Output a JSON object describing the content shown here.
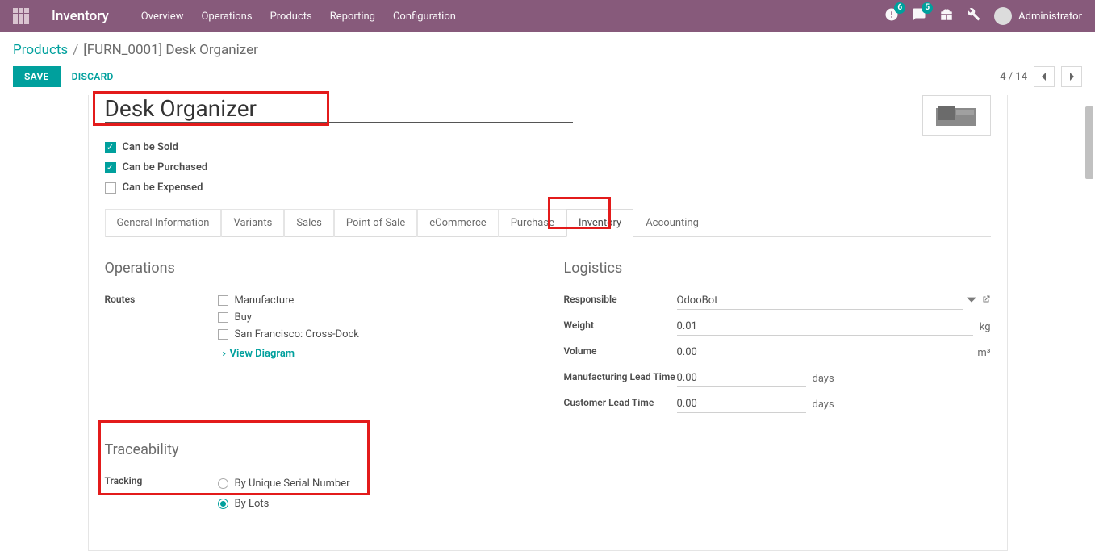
{
  "topbar": {
    "app_name": "Inventory",
    "nav": [
      "Overview",
      "Operations",
      "Products",
      "Reporting",
      "Configuration"
    ],
    "badge_activities": "6",
    "badge_messages": "5",
    "user_name": "Administrator"
  },
  "breadcrumb": {
    "root": "Products",
    "current": "[FURN_0001] Desk Organizer"
  },
  "actions": {
    "save": "SAVE",
    "discard": "DISCARD",
    "pager": "4 / 14"
  },
  "product": {
    "name": "Desk Organizer",
    "checkboxes": {
      "can_be_sold": {
        "label": "Can be Sold",
        "checked": true
      },
      "can_be_purchased": {
        "label": "Can be Purchased",
        "checked": true
      },
      "can_be_expensed": {
        "label": "Can be Expensed",
        "checked": false
      }
    }
  },
  "tabs": [
    "General Information",
    "Variants",
    "Sales",
    "Point of Sale",
    "eCommerce",
    "Purchase",
    "Inventory",
    "Accounting"
  ],
  "active_tab": "Inventory",
  "operations": {
    "title": "Operations",
    "routes_label": "Routes",
    "routes": [
      "Manufacture",
      "Buy",
      "San Francisco: Cross-Dock"
    ],
    "view_diagram": "View Diagram"
  },
  "logistics": {
    "title": "Logistics",
    "responsible_label": "Responsible",
    "responsible_value": "OdooBot",
    "weight_label": "Weight",
    "weight_value": "0.01",
    "weight_unit": "kg",
    "volume_label": "Volume",
    "volume_value": "0.00",
    "volume_unit": "m³",
    "mfg_lead_label": "Manufacturing Lead Time",
    "mfg_lead_value": "0.00",
    "mfg_lead_unit": "days",
    "cust_lead_label": "Customer Lead Time",
    "cust_lead_value": "0.00",
    "cust_lead_unit": "days"
  },
  "traceability": {
    "title": "Traceability",
    "tracking_label": "Tracking",
    "options": {
      "serial": {
        "label": "By Unique Serial Number",
        "selected": false
      },
      "lots": {
        "label": "By Lots",
        "selected": true
      }
    }
  }
}
